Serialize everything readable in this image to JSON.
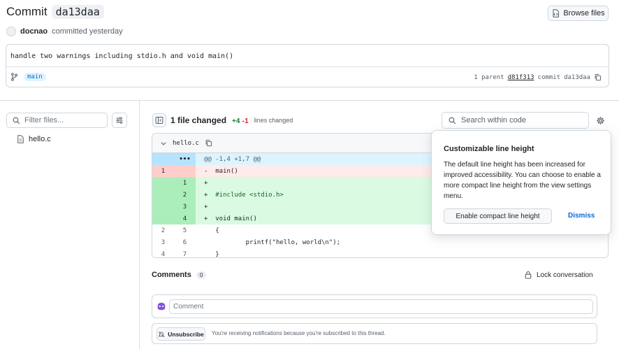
{
  "header": {
    "commit_label": "Commit",
    "commit_sha": "da13daa",
    "browse_files": "Browse files",
    "author": "docnao",
    "committed_when": "committed yesterday"
  },
  "commit": {
    "message": "handle two warnings including stdio.h and void main()",
    "branch": "main",
    "parent_count_label": "1 parent",
    "parent_sha": "d81f313",
    "commit_label": "commit",
    "commit_sha": "da13daa"
  },
  "sidebar": {
    "filter_placeholder": "Filter files...",
    "files": [
      {
        "name": "hello.c"
      }
    ]
  },
  "toolbar": {
    "files_changed": "1 file changed",
    "additions": "+4",
    "deletions": "-1",
    "lines_changed": "lines changed",
    "search_placeholder": "Search within code"
  },
  "diff": {
    "filename": "hello.c",
    "hunk_expander": "•••",
    "hunk": "@@ -1,4 +1,7 @@",
    "rows": [
      {
        "type": "del",
        "old": "1",
        "new": "",
        "sign": "-",
        "text": "main()"
      },
      {
        "type": "add",
        "old": "",
        "new": "1",
        "sign": "+",
        "text": ""
      },
      {
        "type": "add",
        "old": "",
        "new": "2",
        "sign": "+",
        "text": "#include <stdio.h>"
      },
      {
        "type": "add",
        "old": "",
        "new": "3",
        "sign": "+",
        "text": ""
      },
      {
        "type": "add",
        "old": "",
        "new": "4",
        "sign": "+",
        "text": "void main()"
      },
      {
        "type": "ctx",
        "old": "2",
        "new": "5",
        "sign": "",
        "text": "{"
      },
      {
        "type": "ctx",
        "old": "3",
        "new": "6",
        "sign": "",
        "text": "        printf(\"hello, world\\n\");"
      },
      {
        "type": "ctx",
        "old": "4",
        "new": "7",
        "sign": "",
        "text": "}"
      }
    ]
  },
  "popover": {
    "title": "Customizable line height",
    "body": "The default line height has been increased for improved accessibility. You can choose to enable a more compact line height from the view settings menu.",
    "enable_button": "Enable compact line height",
    "dismiss": "Dismiss"
  },
  "comments": {
    "title": "Comments",
    "count": "0",
    "lock": "Lock conversation",
    "placeholder": "Comment",
    "unsubscribe": "Unsubscribe",
    "notification_note": "You're receiving notifications because you're subscribed to this thread."
  },
  "colors": {
    "accent": "#0969da",
    "addition": "#1a7f37",
    "deletion": "#cf222e",
    "border": "#d0d7de"
  }
}
